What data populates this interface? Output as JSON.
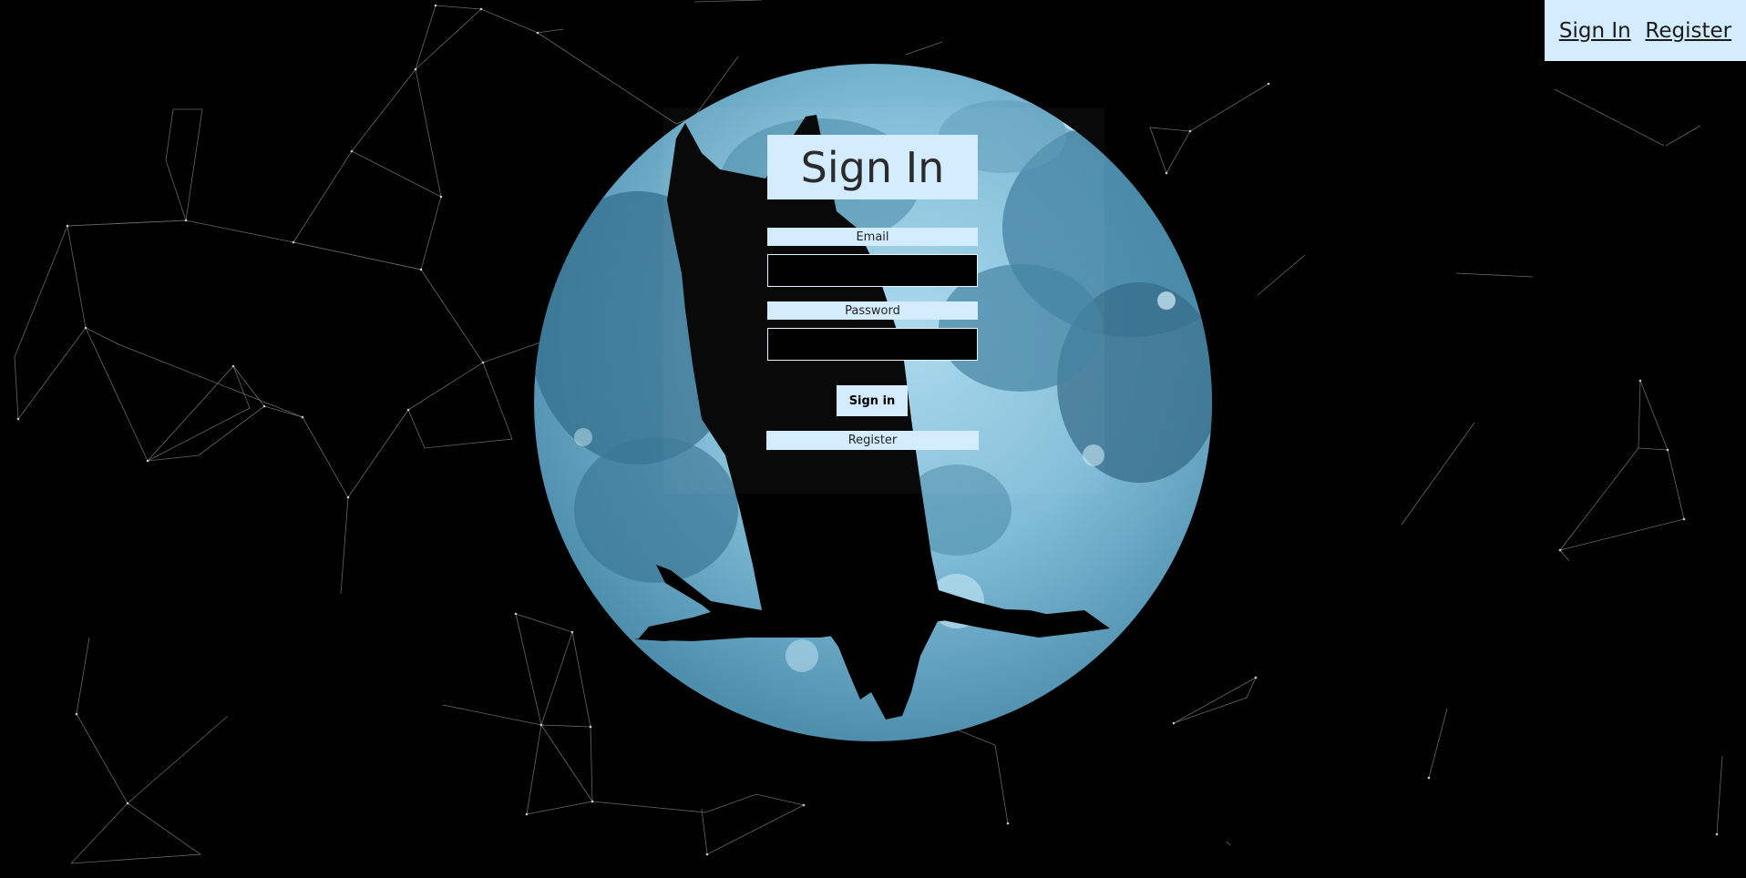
{
  "nav": {
    "signin_link": "Sign In",
    "register_link": "Register"
  },
  "form": {
    "title": "Sign In",
    "email_label": "Email",
    "email_value": "",
    "password_label": "Password",
    "password_value": "",
    "signin_button": "Sign in",
    "register_button": "Register"
  },
  "colors": {
    "background": "#000000",
    "accent": "#d4ecff",
    "moon": "#8fc6e0"
  },
  "icons": {
    "background_art": "moon-owl-illustration",
    "background_pattern": "constellation-network"
  }
}
